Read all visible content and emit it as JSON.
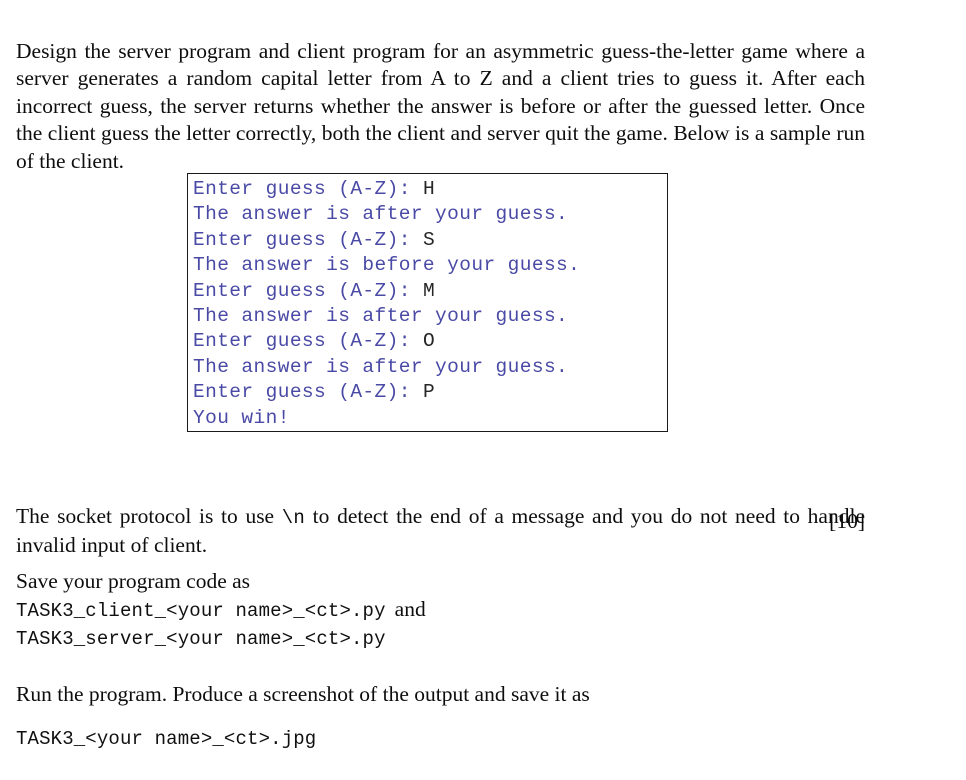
{
  "document": {
    "intro_paragraph": "Design the server program and client program for an asymmetric guess-the-letter game where a server generates a random capital letter from A to Z and a client tries to guess it.  After each incorrect guess, the server returns whether the answer is before or after the guessed letter.  Once the client guess the letter correctly, both the client and server quit the game.  Below is a sample run of the client.",
    "protocol_text_before": "The socket protocol is to use ",
    "protocol_mono": "\\n",
    "protocol_text_after": " to detect the end of a message and you do not need to handle invalid input of client.",
    "marks": "[10]",
    "save_label": "Save your program code as",
    "client_filename": "TASK3_client_<your name>_<ct>.py",
    "and_word": "and",
    "server_filename": "TASK3_server_<your name>_<ct>.py",
    "run_label": "Run the program. Produce a screenshot of the output and save it as",
    "jpg_filename": "TASK3_<your name>_<ct>.jpg"
  },
  "terminal_sample": {
    "text_color": "#4a4aa6",
    "answer_color": "#262626",
    "border_color": "#1a1a1a",
    "background": "#ffffff",
    "lines": [
      {
        "prompt": "Enter guess (A-Z): ",
        "answer": "H"
      },
      {
        "prompt": "The answer is after your guess.",
        "answer": ""
      },
      {
        "prompt": "Enter guess (A-Z): ",
        "answer": "S"
      },
      {
        "prompt": "The answer is before your guess.",
        "answer": ""
      },
      {
        "prompt": "Enter guess (A-Z): ",
        "answer": "M"
      },
      {
        "prompt": "The answer is after your guess.",
        "answer": ""
      },
      {
        "prompt": "Enter guess (A-Z): ",
        "answer": "O"
      },
      {
        "prompt": "The answer is after your guess.",
        "answer": ""
      },
      {
        "prompt": "Enter guess (A-Z): ",
        "answer": "P"
      },
      {
        "prompt": "You win!",
        "answer": ""
      }
    ]
  }
}
